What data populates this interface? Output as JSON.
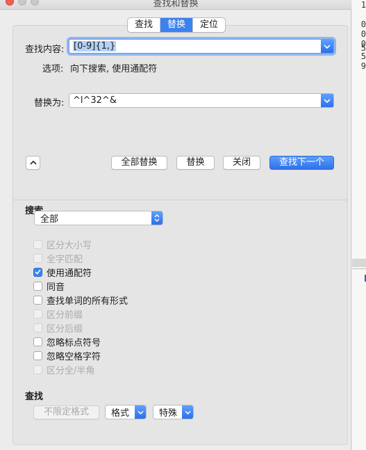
{
  "window": {
    "title": "查找和替换"
  },
  "tabs": [
    {
      "label": "查找",
      "active": false
    },
    {
      "label": "替换",
      "active": true
    },
    {
      "label": "定位",
      "active": false
    }
  ],
  "find": {
    "label": "查找内容:",
    "value": "[0-9]{1,}"
  },
  "options": {
    "label": "选项:",
    "value": "向下搜索, 使用通配符"
  },
  "replace": {
    "label": "替换为:",
    "value": "^l^32^&"
  },
  "buttons": {
    "replace_all": "全部替换",
    "replace": "替换",
    "close": "关闭",
    "find_next": "查找下一个"
  },
  "search_section": {
    "heading": "搜索",
    "direction": "全部"
  },
  "checkboxes": [
    {
      "label": "区分大小写",
      "checked": false,
      "disabled": true
    },
    {
      "label": "全字匹配",
      "checked": false,
      "disabled": true
    },
    {
      "label": "使用通配符",
      "checked": true,
      "disabled": false
    },
    {
      "label": "同音",
      "checked": false,
      "disabled": false
    },
    {
      "label": "查找单词的所有形式",
      "checked": false,
      "disabled": false
    },
    {
      "label": "区分前缀",
      "checked": false,
      "disabled": true
    },
    {
      "label": "区分后缀",
      "checked": false,
      "disabled": true
    },
    {
      "label": "忽略标点符号",
      "checked": false,
      "disabled": false
    },
    {
      "label": "忽略空格字符",
      "checked": false,
      "disabled": false
    },
    {
      "label": "区分全/半角",
      "checked": false,
      "disabled": true
    }
  ],
  "find_section": {
    "heading": "查找",
    "no_format": "不限定格式",
    "format": "格式",
    "special": "特殊"
  },
  "background_text": [
    "1",
    "0",
    "0",
    "0",
    "5",
    "5",
    "9"
  ],
  "colors": {
    "accent": "#3b82f0",
    "disabled_text": "#a7a7a7"
  }
}
